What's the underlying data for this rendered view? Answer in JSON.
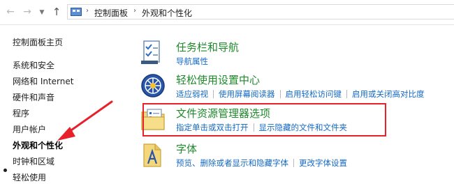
{
  "address_bar": {
    "breadcrumbs": [
      "控制面板",
      "外观和个性化"
    ]
  },
  "left_nav": {
    "items": [
      {
        "label": "控制面板主页",
        "current": false
      },
      {
        "label": "系统和安全",
        "current": false
      },
      {
        "label": "网络和 Internet",
        "current": false
      },
      {
        "label": "硬件和声音",
        "current": false
      },
      {
        "label": "程序",
        "current": false
      },
      {
        "label": "用户帐户",
        "current": false
      },
      {
        "label": "外观和个性化",
        "current": true
      },
      {
        "label": "时钟和区域",
        "current": false
      },
      {
        "label": "轻松使用",
        "current": false
      }
    ]
  },
  "categories": [
    {
      "icon": "taskbar-icon",
      "title": "任务栏和导航",
      "links": [
        "导航属性"
      ]
    },
    {
      "icon": "ease-of-access-icon",
      "title": "轻松使用设置中心",
      "links": [
        "适应弱视",
        "使用屏幕阅读器",
        "启用轻松访问键",
        "启用或关闭高对比度"
      ]
    },
    {
      "icon": "folder-options-icon",
      "title": "文件资源管理器选项",
      "links": [
        "指定单击或双击打开",
        "显示隐藏的文件和文件夹"
      ]
    },
    {
      "icon": "fonts-icon",
      "title": "字体",
      "links": [
        "预览、删除或者显示和隐藏字体",
        "更改字体设置"
      ]
    }
  ],
  "colors": {
    "category_title": "#1e8a2a",
    "link": "#1469c3",
    "annotation_red": "#e8202a"
  }
}
